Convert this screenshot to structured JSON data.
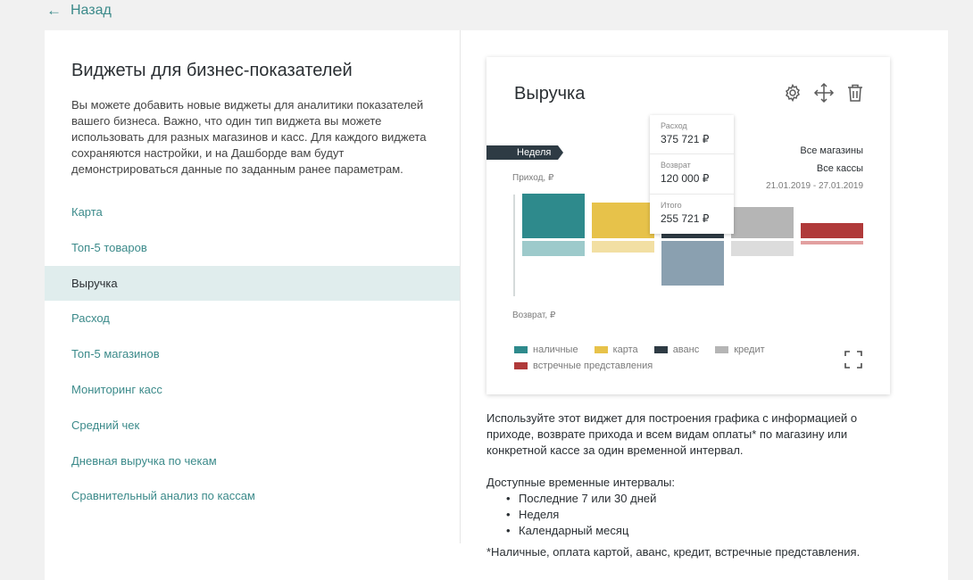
{
  "back": {
    "label": "Назад"
  },
  "left": {
    "title": "Виджеты для бизнес-показателей",
    "description": "Вы можете добавить новые виджеты для аналитики показателей вашего бизнеса. Важно, что один тип виджета вы можете использовать для разных магазинов и касс. Для каждого виджета сохраняются настройки, и на Дашборде вам будут демонстрироваться данные по заданным ранее параметрам.",
    "menu": [
      {
        "label": "Карта",
        "active": false
      },
      {
        "label": "Топ-5 товаров",
        "active": false
      },
      {
        "label": "Выручка",
        "active": true
      },
      {
        "label": "Расход",
        "active": false
      },
      {
        "label": "Топ-5 магазинов",
        "active": false
      },
      {
        "label": "Мониторинг касс",
        "active": false
      },
      {
        "label": "Средний чек",
        "active": false
      },
      {
        "label": "Дневная выручка по чекам",
        "active": false
      },
      {
        "label": "Сравнительный анализ по кассам",
        "active": false
      }
    ]
  },
  "widget": {
    "title": "Выручка",
    "icons": [
      "gear-icon",
      "move-icon",
      "trash-icon",
      "expand-icon"
    ],
    "period": "Неделя",
    "store": "Все магазины",
    "register": "Все кассы",
    "dates": "21.01.2019 - 27.01.2019",
    "income_label": "Приход, ₽",
    "return_label": "Возврат, ₽",
    "tooltip": [
      {
        "label": "Расход",
        "value": "375 721 ₽"
      },
      {
        "label": "Возврат",
        "value": "120 000 ₽"
      },
      {
        "label": "Итого",
        "value": "255 721 ₽"
      }
    ],
    "legend": [
      {
        "name": "наличные",
        "color": "#2e8a8c"
      },
      {
        "name": "карта",
        "color": "#e7c24a"
      },
      {
        "name": "аванс",
        "color": "#2e3b44"
      },
      {
        "name": "кредит",
        "color": "#b5b5b5"
      },
      {
        "name": "встречные представления",
        "color": "#b03a3a"
      }
    ]
  },
  "chart_data": {
    "type": "bar",
    "categories": [
      "наличные",
      "карта",
      "аванс",
      "кредит",
      "встречные представления"
    ],
    "series": [
      {
        "name": "Приход, ₽",
        "values": [
          50,
          40,
          60,
          35,
          17
        ]
      },
      {
        "name": "Возврат, ₽",
        "values": [
          17,
          13,
          50,
          17,
          4
        ]
      }
    ],
    "colors": [
      "#2e8a8c",
      "#e7c24a",
      "#2e3b44",
      "#b5b5b5",
      "#b03a3a"
    ],
    "return_colors": [
      "#9dcacb",
      "#f2dfa3",
      "#8aa0b0",
      "#dcdcdc",
      "#e2a0a0"
    ],
    "ylim": [
      -60,
      60
    ],
    "ylabel": "Приход, ₽",
    "ylabel_negative": "Возврат, ₽"
  },
  "info": {
    "text": "Используйте этот виджет для построения графика с информацией о приходе, возврате прихода и всем видам оплаты* по магазину или конкретной кассе за один временной интервал.",
    "intervals_title": "Доступные временные интервалы:",
    "intervals": [
      "Последние 7 или 30 дней",
      "Неделя",
      "Календарный месяц"
    ],
    "footnote": "*Наличные, оплата картой, аванс, кредит, встречные представления."
  }
}
